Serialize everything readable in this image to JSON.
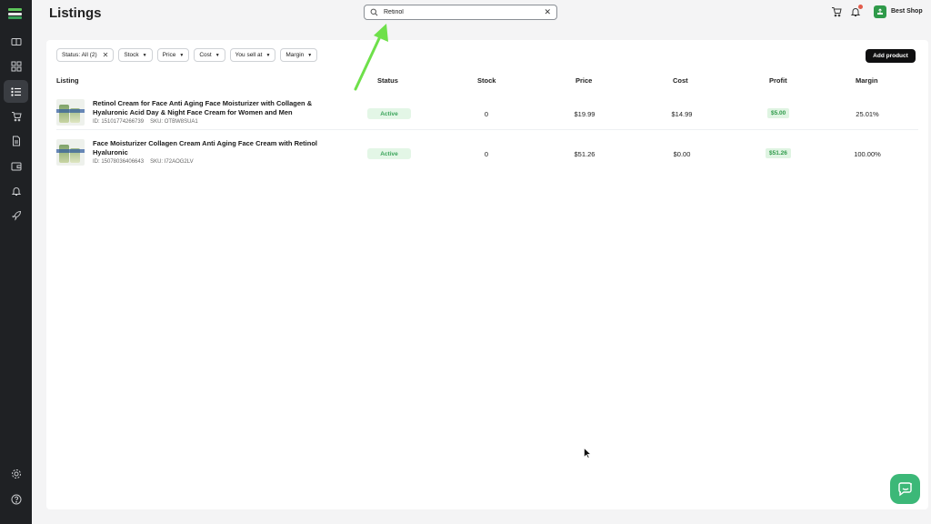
{
  "header": {
    "title": "Listings",
    "search": {
      "value": "Retinol",
      "placeholder": ""
    },
    "shop_name": "Best Shop"
  },
  "sidebar": {
    "items": [
      {
        "icon": "catalog-icon"
      },
      {
        "icon": "dashboard-icon"
      },
      {
        "icon": "listings-icon",
        "active": true
      },
      {
        "icon": "cart-icon"
      },
      {
        "icon": "document-icon"
      },
      {
        "icon": "wallet-icon"
      },
      {
        "icon": "bell-icon"
      },
      {
        "icon": "rocket-icon"
      },
      {
        "icon": "settings-icon"
      },
      {
        "icon": "help-icon"
      }
    ]
  },
  "filters": {
    "status": "Status: All (2)",
    "stock": "Stock",
    "price": "Price",
    "cost": "Cost",
    "you_sell_at": "You sell at",
    "margin": "Margin"
  },
  "actions": {
    "add_product": "Add product"
  },
  "table": {
    "headers": {
      "listing": "Listing",
      "status": "Status",
      "stock": "Stock",
      "price": "Price",
      "cost": "Cost",
      "profit": "Profit",
      "margin": "Margin"
    },
    "rows": [
      {
        "title": "Retinol Cream for Face Anti Aging Face Moisturizer with Collagen & Hyaluronic Acid Day & Night Face Cream for Women and Men",
        "id": "ID: 15101774266739",
        "sku": "SKU: OTBW8SUA1",
        "status": "Active",
        "stock": "0",
        "price": "$19.99",
        "cost": "$14.99",
        "profit": "$5.00",
        "margin": "25.01%"
      },
      {
        "title": "Face Moisturizer Collagen Cream Anti Aging Face Cream with Retinol Hyaluronic",
        "id": "ID: 15078036406643",
        "sku": "SKU: I72AOG2LV",
        "status": "Active",
        "stock": "0",
        "price": "$51.26",
        "cost": "$0.00",
        "profit": "$51.26",
        "margin": "100.00%"
      }
    ]
  },
  "colors": {
    "sidebar": "#1f2124",
    "accent_green": "#3aa45a",
    "annotation_arrow": "#6ee04a"
  }
}
